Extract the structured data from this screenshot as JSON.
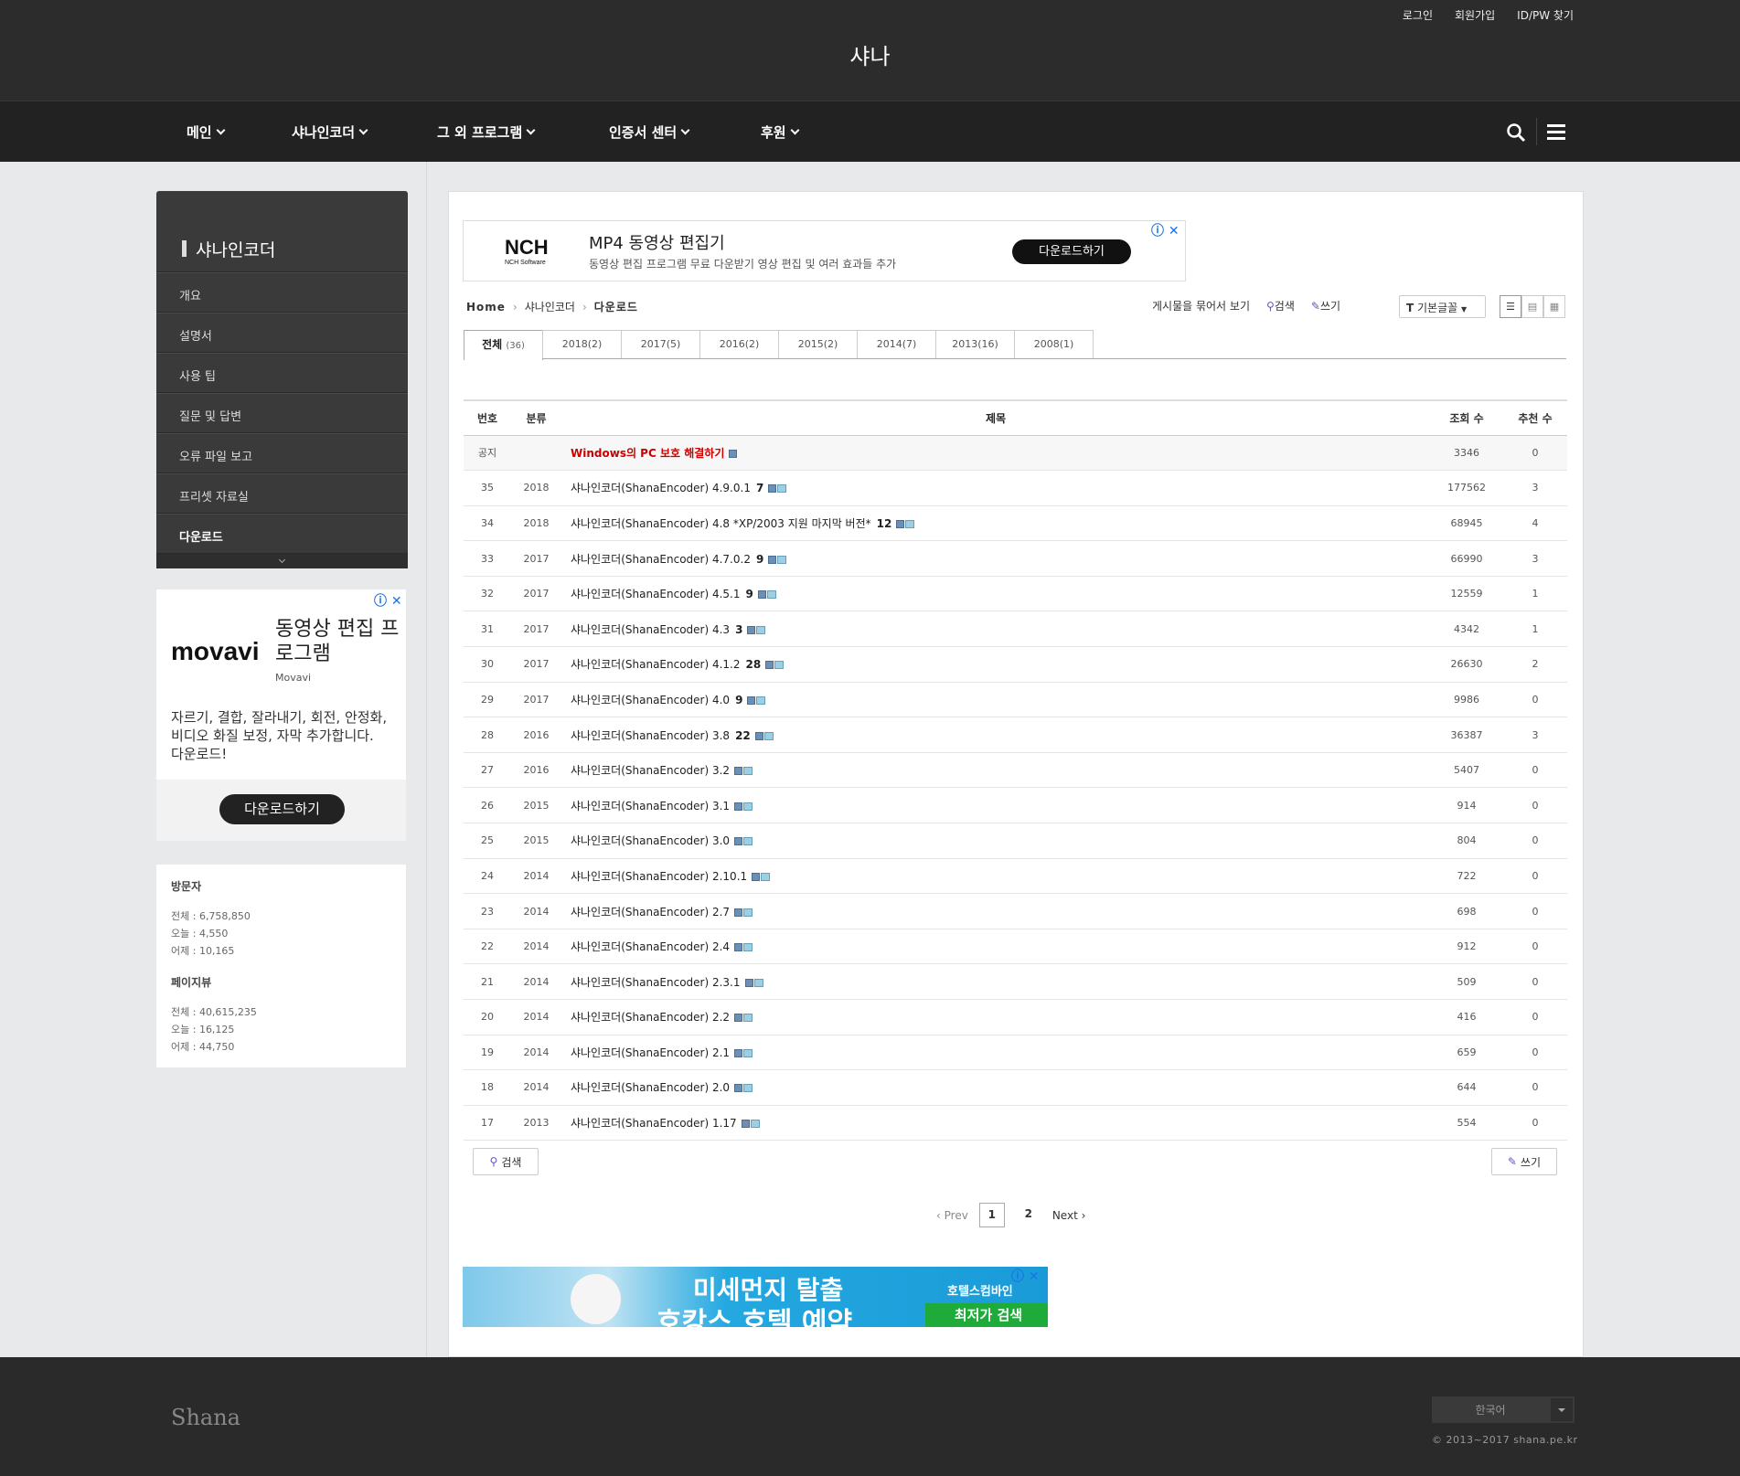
{
  "header": {
    "util_links": [
      "로그인",
      "회원가입",
      "ID/PW 찾기"
    ],
    "logo": "샤나"
  },
  "nav": {
    "items": [
      "메인",
      "샤나인코더",
      "그 외 프로그램",
      "인증서 센터",
      "후원"
    ]
  },
  "sidebar": {
    "title": "샤나인코더",
    "items": [
      "개요",
      "설명서",
      "사용 팁",
      "질문 및 답변",
      "오류 파일 보고",
      "프리셋 자료실",
      "다운로드"
    ],
    "active_index": 6
  },
  "ad_side": {
    "logo": "movavi",
    "headline": "동영상 편집 프로그램",
    "brand": "Movavi",
    "desc": "자르기, 결합, 잘라내기, 회전, 안정화, 비디오 화질 보정, 자막 추가합니다. 다운로드!",
    "button": "다운로드하기"
  },
  "visitors": {
    "title": "방문자",
    "total": "전체 : 6,758,850",
    "today": "오늘 : 4,550",
    "yesterday": "어제 : 10,165",
    "pv_title": "페이지뷰",
    "pv_total": "전체 : 40,615,235",
    "pv_today": "오늘 : 16,125",
    "pv_yesterday": "어제 : 44,750"
  },
  "ad_top": {
    "logo": "NCH",
    "logo_sub": "NCH Software",
    "title": "MP4 동영상 편집기",
    "subtitle": "동영상 편집 프로그램 무료 다운받기 영상 편집 및 여러 효과들 추가",
    "button": "다운로드하기"
  },
  "breadcrumb": {
    "home": "Home",
    "parent": "샤나인코더",
    "current": "다운로드"
  },
  "board_tools": {
    "grouped_view": "게시물을 묶어서 보기",
    "search": "검색",
    "write": "쓰기",
    "sort": "기본글꼴"
  },
  "tabs": [
    {
      "label": "전체",
      "count": "(36)"
    },
    {
      "label": "2018(2)"
    },
    {
      "label": "2017(5)"
    },
    {
      "label": "2016(2)"
    },
    {
      "label": "2015(2)"
    },
    {
      "label": "2014(7)"
    },
    {
      "label": "2013(16)"
    },
    {
      "label": "2008(1)"
    }
  ],
  "table": {
    "headers": [
      "번호",
      "분류",
      "제목",
      "조회 수",
      "추천 수"
    ],
    "notice": {
      "no": "공지",
      "cat": "",
      "title": "Windows의 PC 보호 해결하기",
      "views": "3346",
      "rec": "0"
    },
    "rows": [
      {
        "no": "35",
        "cat": "2018",
        "title": "샤나인코더(ShanaEncoder) 4.9.0.1",
        "comments": "7",
        "views": "177562",
        "rec": "3"
      },
      {
        "no": "34",
        "cat": "2018",
        "title": "샤나인코더(ShanaEncoder) 4.8 *XP/2003 지원 마지막 버전*",
        "comments": "12",
        "views": "68945",
        "rec": "4"
      },
      {
        "no": "33",
        "cat": "2017",
        "title": "샤나인코더(ShanaEncoder) 4.7.0.2",
        "comments": "9",
        "views": "66990",
        "rec": "3"
      },
      {
        "no": "32",
        "cat": "2017",
        "title": "샤나인코더(ShanaEncoder) 4.5.1",
        "comments": "9",
        "views": "12559",
        "rec": "1"
      },
      {
        "no": "31",
        "cat": "2017",
        "title": "샤나인코더(ShanaEncoder) 4.3",
        "comments": "3",
        "views": "4342",
        "rec": "1"
      },
      {
        "no": "30",
        "cat": "2017",
        "title": "샤나인코더(ShanaEncoder) 4.1.2",
        "comments": "28",
        "views": "26630",
        "rec": "2"
      },
      {
        "no": "29",
        "cat": "2017",
        "title": "샤나인코더(ShanaEncoder) 4.0",
        "comments": "9",
        "views": "9986",
        "rec": "0"
      },
      {
        "no": "28",
        "cat": "2016",
        "title": "샤나인코더(ShanaEncoder) 3.8",
        "comments": "22",
        "views": "36387",
        "rec": "3"
      },
      {
        "no": "27",
        "cat": "2016",
        "title": "샤나인코더(ShanaEncoder) 3.2",
        "comments": "",
        "views": "5407",
        "rec": "0"
      },
      {
        "no": "26",
        "cat": "2015",
        "title": "샤나인코더(ShanaEncoder) 3.1",
        "comments": "",
        "views": "914",
        "rec": "0"
      },
      {
        "no": "25",
        "cat": "2015",
        "title": "샤나인코더(ShanaEncoder) 3.0",
        "comments": "",
        "views": "804",
        "rec": "0"
      },
      {
        "no": "24",
        "cat": "2014",
        "title": "샤나인코더(ShanaEncoder) 2.10.1",
        "comments": "",
        "views": "722",
        "rec": "0"
      },
      {
        "no": "23",
        "cat": "2014",
        "title": "샤나인코더(ShanaEncoder) 2.7",
        "comments": "",
        "views": "698",
        "rec": "0"
      },
      {
        "no": "22",
        "cat": "2014",
        "title": "샤나인코더(ShanaEncoder) 2.4",
        "comments": "",
        "views": "912",
        "rec": "0"
      },
      {
        "no": "21",
        "cat": "2014",
        "title": "샤나인코더(ShanaEncoder) 2.3.1",
        "comments": "",
        "views": "509",
        "rec": "0"
      },
      {
        "no": "20",
        "cat": "2014",
        "title": "샤나인코더(ShanaEncoder) 2.2",
        "comments": "",
        "views": "416",
        "rec": "0"
      },
      {
        "no": "19",
        "cat": "2014",
        "title": "샤나인코더(ShanaEncoder) 2.1",
        "comments": "",
        "views": "659",
        "rec": "0"
      },
      {
        "no": "18",
        "cat": "2014",
        "title": "샤나인코더(ShanaEncoder) 2.0",
        "comments": "",
        "views": "644",
        "rec": "0"
      },
      {
        "no": "17",
        "cat": "2013",
        "title": "샤나인코더(ShanaEncoder) 1.17",
        "comments": "",
        "views": "554",
        "rec": "0"
      }
    ]
  },
  "bottom_buttons": {
    "search": "검색",
    "write": "쓰기"
  },
  "pager": {
    "prev": "Prev",
    "pages": [
      "1",
      "2"
    ],
    "next": "Next"
  },
  "ad_bottom": {
    "line1": "미세먼지 탈출",
    "line2": "호캉스 호텔 예약",
    "brand": "호텔스컴바인",
    "cta": "최저가 검색"
  },
  "footer": {
    "logo": "Shana",
    "language": "한국어",
    "copyright": "© 2013~2017 shana.pe.kr"
  },
  "colors": {
    "header_bg": "#2c2c2c",
    "nav_bg": "#222222",
    "page_bg": "#e8e9eb",
    "notice_title": "#cc0000",
    "footer_bg": "#2a2a2a"
  }
}
